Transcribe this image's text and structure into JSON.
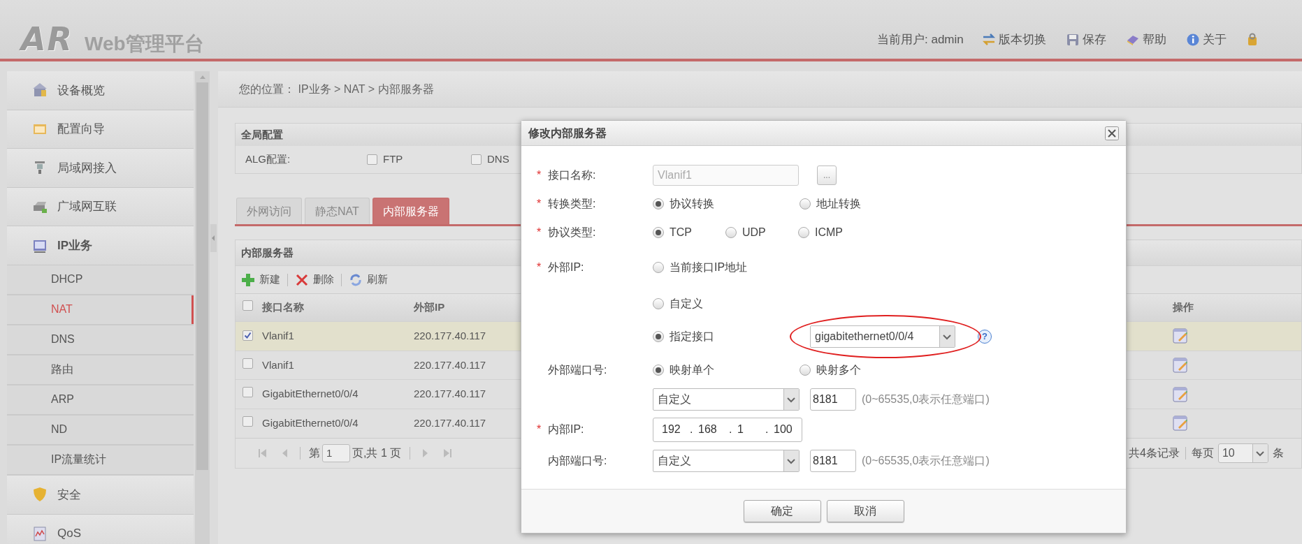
{
  "header": {
    "logo": "AR",
    "title": "Web管理平台",
    "user": "当前用户: admin",
    "menu": [
      {
        "kind": "switch",
        "label": "版本切换"
      },
      {
        "kind": "save",
        "label": "保存"
      },
      {
        "kind": "help",
        "label": "帮助"
      },
      {
        "kind": "info",
        "label": "关于"
      },
      {
        "kind": "logout"
      }
    ]
  },
  "sidebar": {
    "items": [
      {
        "label": "设备概览",
        "selected": false,
        "expanded": false
      },
      {
        "label": "配置向导",
        "selected": false,
        "expanded": false
      },
      {
        "label": "局域网接入",
        "selected": false,
        "expanded": false
      },
      {
        "label": "广域网互联",
        "selected": false,
        "expanded": false
      },
      {
        "label": "IP业务",
        "selected": false,
        "expanded": true,
        "children": [
          {
            "label": "DHCP",
            "selected": false
          },
          {
            "label": "NAT",
            "selected": true
          },
          {
            "label": "DNS",
            "selected": false
          },
          {
            "label": "路由",
            "selected": false
          },
          {
            "label": "ARP",
            "selected": false
          },
          {
            "label": "ND",
            "selected": false
          },
          {
            "label": "IP流量统计",
            "selected": false
          }
        ]
      },
      {
        "label": "安全",
        "selected": false,
        "expanded": false
      },
      {
        "label": "QoS",
        "selected": false,
        "expanded": false
      }
    ]
  },
  "breadcrumb": "您的位置： IP业务 > NAT > 内部服务器",
  "global_config": {
    "title": "全局配置",
    "label": "ALG配置:",
    "options": [
      {
        "label": "FTP",
        "checked": false
      },
      {
        "label": "DNS",
        "checked": false
      }
    ]
  },
  "tabs": [
    {
      "label": "外网访问",
      "selected": false
    },
    {
      "label": "静态NAT",
      "selected": false
    },
    {
      "label": "内部服务器",
      "selected": true
    }
  ],
  "server_panel": {
    "title": "内部服务器",
    "toolbar": [
      {
        "kind": "add",
        "label": "新建"
      },
      {
        "kind": "delete",
        "label": "删除"
      },
      {
        "kind": "refresh",
        "label": "刷新"
      }
    ],
    "table": {
      "header_checked": false,
      "columns": [
        "接口名称",
        "外部IP",
        "操作"
      ],
      "rows": [
        {
          "selected": true,
          "checked": true,
          "cells": [
            "Vlanif1",
            "220.177.40.117"
          ]
        },
        {
          "selected": false,
          "checked": false,
          "cells": [
            "Vlanif1",
            "220.177.40.117"
          ]
        },
        {
          "selected": false,
          "checked": false,
          "cells": [
            "GigabitEthernet0/0/4",
            "220.177.40.117"
          ]
        },
        {
          "selected": false,
          "checked": false,
          "cells": [
            "GigabitEthernet0/0/4",
            "220.177.40.117"
          ]
        }
      ]
    },
    "pager": {
      "page_prefix": "第",
      "page": "1",
      "page_suffix": "页,共 1 页",
      "total": "共4条记录",
      "per_page_label": "每页",
      "per_page": "10",
      "per_page_suffix": "条"
    }
  },
  "dialog": {
    "title": "修改内部服务器",
    "fields": [
      {
        "kind": "input",
        "marker": "*",
        "label": "接口名称:",
        "value": "Vlanif1",
        "disabled": true,
        "button": "..."
      },
      {
        "kind": "radio",
        "marker": "*",
        "label": "转换类型:",
        "options": [
          {
            "label": "协议转换",
            "selected": true
          },
          {
            "label": "地址转换",
            "selected": false
          }
        ]
      },
      {
        "kind": "radio",
        "marker": "*",
        "label": "协议类型:",
        "options": [
          {
            "label": "TCP",
            "selected": true
          },
          {
            "label": "UDP",
            "selected": false
          },
          {
            "label": "ICMP",
            "selected": false
          }
        ]
      },
      {
        "kind": "radio",
        "marker": "*",
        "label": "外部IP:",
        "options": [
          {
            "label": "当前接口IP地址",
            "selected": false
          }
        ]
      },
      {
        "kind": "radio",
        "options": [
          {
            "label": "自定义",
            "selected": false
          }
        ]
      },
      {
        "kind": "radio",
        "options": [
          {
            "label": "指定接口",
            "selected": true
          }
        ],
        "select": "gigabitethernet0/0/4",
        "help": "?",
        "circled": true
      },
      {
        "kind": "radio",
        "label": "外部端口号:",
        "options": [
          {
            "label": "映射单个",
            "selected": true
          },
          {
            "label": "映射多个",
            "selected": false
          }
        ]
      },
      {
        "kind": "port",
        "select": "自定义",
        "value": "8181",
        "hint": "(0~65535,0表示任意端口)"
      },
      {
        "kind": "ip",
        "marker": "*",
        "label": "内部IP:",
        "separator": ".",
        "octets": [
          "192",
          "168",
          "1",
          "100"
        ]
      },
      {
        "kind": "port",
        "label": "内部端口号:",
        "select": "自定义",
        "value": "8181",
        "hint": "(0~65535,0表示任意端口)"
      }
    ],
    "buttons": [
      "确定",
      "取消"
    ]
  }
}
